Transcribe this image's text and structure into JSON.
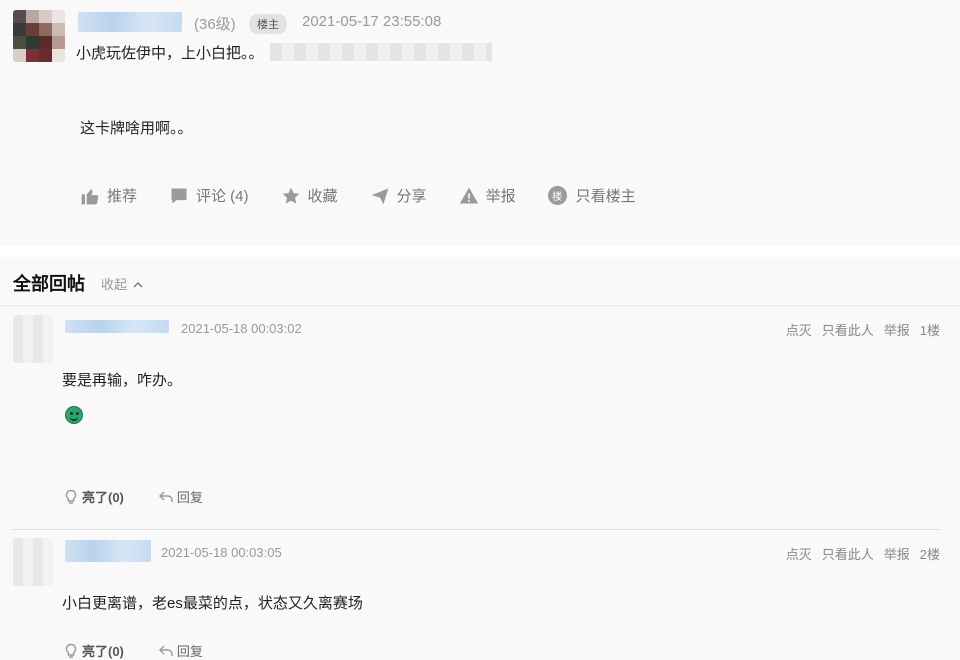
{
  "op": {
    "level": "(36级)",
    "owner_badge": "楼主",
    "time": "2021-05-17 23:55:08",
    "title": "小虎玩佐伊中，上小白把。。",
    "body": "这卡牌啥用啊。。",
    "actions": {
      "recommend": "推荐",
      "comment": "评论 (4)",
      "favorite": "收藏",
      "share": "分享",
      "report": "举报",
      "only_owner": "只看楼主",
      "only_owner_badge": "楼"
    }
  },
  "replies_section": {
    "title": "全部回帖",
    "collapse": "收起"
  },
  "replies": [
    {
      "time": "2021-05-18 00:03:02",
      "downvote": "点灭",
      "only_this": "只看此人",
      "report": "举报",
      "floor": "1楼",
      "text": "要是再输，咋办。",
      "like": "亮了(0)",
      "reply": "回复",
      "has_emoji": true
    },
    {
      "time": "2021-05-18 00:03:05",
      "downvote": "点灭",
      "only_this": "只看此人",
      "report": "举报",
      "floor": "2楼",
      "text": "小白更离谱，老es最菜的点，状态又久离赛场",
      "like": "亮了(0)",
      "reply": "回复"
    }
  ],
  "icons": [
    "thumbs-up-icon",
    "comment-icon",
    "star-icon",
    "share-icon",
    "warning-icon",
    "owner-badge-icon",
    "chevron-up-icon",
    "lightbulb-icon",
    "reply-arrow-icon",
    "smile-emoji-icon"
  ]
}
